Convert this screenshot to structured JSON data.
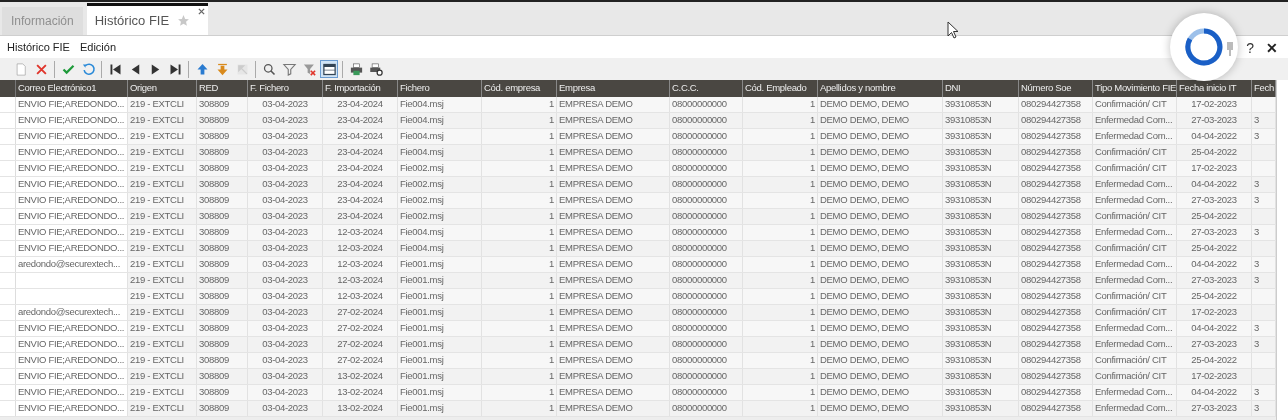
{
  "tabs": [
    {
      "label": "Información",
      "selected": false,
      "closable": false
    },
    {
      "label": "Histórico FIE",
      "selected": true,
      "closable": true
    }
  ],
  "menu": [
    {
      "label": "Histórico FIE"
    },
    {
      "label": "Edición"
    }
  ],
  "window_controls": [
    {
      "kind": "pin"
    },
    {
      "kind": "help",
      "label": "?"
    },
    {
      "kind": "close",
      "label": "✕"
    }
  ],
  "loading": true,
  "toolbar": [
    {
      "kind": "new",
      "disabled": false
    },
    {
      "kind": "delete",
      "disabled": false
    },
    {
      "kind": "separator"
    },
    {
      "kind": "accept",
      "disabled": false
    },
    {
      "kind": "undo",
      "disabled": false
    },
    {
      "kind": "separator"
    },
    {
      "kind": "first",
      "disabled": false
    },
    {
      "kind": "prev",
      "disabled": false
    },
    {
      "kind": "next",
      "disabled": false
    },
    {
      "kind": "last",
      "disabled": false
    },
    {
      "kind": "separator"
    },
    {
      "kind": "up",
      "disabled": false
    },
    {
      "kind": "down",
      "disabled": false
    },
    {
      "kind": "diagonal",
      "disabled": true
    },
    {
      "kind": "separator"
    },
    {
      "kind": "search",
      "disabled": false
    },
    {
      "kind": "filter",
      "disabled": false
    },
    {
      "kind": "clearfilter",
      "disabled": false
    },
    {
      "kind": "grid",
      "disabled": false,
      "pressed": true
    },
    {
      "kind": "separator"
    },
    {
      "kind": "print",
      "disabled": false
    },
    {
      "kind": "preview",
      "disabled": false
    }
  ],
  "table": {
    "columns": [
      "Correo Electrónico1",
      "Origen",
      "RED",
      "F. Fichero",
      "F. Importación",
      "Fichero",
      "Cód. empresa",
      "Empresa",
      "C.C.C.",
      "Cód. Empleado",
      "Apellidos y nombre",
      "DNI",
      "Número Soe",
      "Tipo Movimiento FIE",
      "Fecha inicio IT",
      "Fech"
    ],
    "rows": [
      {
        "correo": "ENVIO FIE;AREDONDO...",
        "origen": "219 - EXTCLI",
        "red": "308809",
        "f_fichero": "03-04-2023",
        "f_importacion": "23-04-2024",
        "fichero": "Fie004.msj",
        "cod_empresa": "1",
        "empresa": "EMPRESA DEMO",
        "ccc": "08000000000",
        "cod_empleado": "1",
        "nombre": "DEMO DEMO, DEMO",
        "dni": "39310853N",
        "soe": "080294427358",
        "tipo": "Confirmación/ CIT",
        "fecha_inicio": "17-02-2023"
      },
      {
        "correo": "ENVIO FIE;AREDONDO...",
        "origen": "219 - EXTCLI",
        "red": "308809",
        "f_fichero": "03-04-2023",
        "f_importacion": "23-04-2024",
        "fichero": "Fie004.msj",
        "cod_empresa": "1",
        "empresa": "EMPRESA DEMO",
        "ccc": "08000000000",
        "cod_empleado": "1",
        "nombre": "DEMO DEMO, DEMO",
        "dni": "39310853N",
        "soe": "080294427358",
        "tipo": "Enfermedad Com...",
        "fecha_inicio": "27-03-2023",
        "column_16": "3"
      },
      {
        "correo": "ENVIO FIE;AREDONDO...",
        "origen": "219 - EXTCLI",
        "red": "308809",
        "f_fichero": "03-04-2023",
        "f_importacion": "23-04-2024",
        "fichero": "Fie004.msj",
        "cod_empresa": "1",
        "empresa": "EMPRESA DEMO",
        "ccc": "08000000000",
        "cod_empleado": "1",
        "nombre": "DEMO DEMO, DEMO",
        "dni": "39310853N",
        "soe": "080294427358",
        "tipo": "Enfermedad Com...",
        "fecha_inicio": "04-04-2022",
        "column_16": "3"
      },
      {
        "correo": "ENVIO FIE;AREDONDO...",
        "origen": "219 - EXTCLI",
        "red": "308809",
        "f_fichero": "03-04-2023",
        "f_importacion": "23-04-2024",
        "fichero": "Fie004.msj",
        "cod_empresa": "1",
        "empresa": "EMPRESA DEMO",
        "ccc": "08000000000",
        "cod_empleado": "1",
        "nombre": "DEMO DEMO, DEMO",
        "dni": "39310853N",
        "soe": "080294427358",
        "tipo": "Confirmación/ CIT",
        "fecha_inicio": "25-04-2022"
      },
      {
        "correo": "ENVIO FIE;AREDONDO...",
        "origen": "219 - EXTCLI",
        "red": "308809",
        "f_fichero": "03-04-2023",
        "f_importacion": "23-04-2024",
        "fichero": "Fie002.msj",
        "cod_empresa": "1",
        "empresa": "EMPRESA DEMO",
        "ccc": "08000000000",
        "cod_empleado": "1",
        "nombre": "DEMO DEMO, DEMO",
        "dni": "39310853N",
        "soe": "080294427358",
        "tipo": "Confirmación/ CIT",
        "fecha_inicio": "17-02-2023"
      },
      {
        "correo": "ENVIO FIE;AREDONDO...",
        "origen": "219 - EXTCLI",
        "red": "308809",
        "f_fichero": "03-04-2023",
        "f_importacion": "23-04-2024",
        "fichero": "Fie002.msj",
        "cod_empresa": "1",
        "empresa": "EMPRESA DEMO",
        "ccc": "08000000000",
        "cod_empleado": "1",
        "nombre": "DEMO DEMO, DEMO",
        "dni": "39310853N",
        "soe": "080294427358",
        "tipo": "Enfermedad Com...",
        "fecha_inicio": "04-04-2022",
        "column_16": "3"
      },
      {
        "correo": "ENVIO FIE;AREDONDO...",
        "origen": "219 - EXTCLI",
        "red": "308809",
        "f_fichero": "03-04-2023",
        "f_importacion": "23-04-2024",
        "fichero": "Fie002.msj",
        "cod_empresa": "1",
        "empresa": "EMPRESA DEMO",
        "ccc": "08000000000",
        "cod_empleado": "1",
        "nombre": "DEMO DEMO, DEMO",
        "dni": "39310853N",
        "soe": "080294427358",
        "tipo": "Enfermedad Com...",
        "fecha_inicio": "27-03-2023",
        "column_16": "3"
      },
      {
        "correo": "ENVIO FIE;AREDONDO...",
        "origen": "219 - EXTCLI",
        "red": "308809",
        "f_fichero": "03-04-2023",
        "f_importacion": "23-04-2024",
        "fichero": "Fie002.msj",
        "cod_empresa": "1",
        "empresa": "EMPRESA DEMO",
        "ccc": "08000000000",
        "cod_empleado": "1",
        "nombre": "DEMO DEMO, DEMO",
        "dni": "39310853N",
        "soe": "080294427358",
        "tipo": "Confirmación/ CIT",
        "fecha_inicio": "25-04-2022"
      },
      {
        "correo": "ENVIO FIE;AREDONDO...",
        "origen": "219 - EXTCLI",
        "red": "308809",
        "f_fichero": "03-04-2023",
        "f_importacion": "12-03-2024",
        "fichero": "Fie004.msj",
        "cod_empresa": "1",
        "empresa": "EMPRESA DEMO",
        "ccc": "08000000000",
        "cod_empleado": "1",
        "nombre": "DEMO DEMO, DEMO",
        "dni": "39310853N",
        "soe": "080294427358",
        "tipo": "Enfermedad Com...",
        "fecha_inicio": "27-03-2023",
        "column_16": "3"
      },
      {
        "correo": "ENVIO FIE;AREDONDO...",
        "origen": "219 - EXTCLI",
        "red": "308809",
        "f_fichero": "03-04-2023",
        "f_importacion": "12-03-2024",
        "fichero": "Fie004.msj",
        "cod_empresa": "1",
        "empresa": "EMPRESA DEMO",
        "ccc": "08000000000",
        "cod_empleado": "1",
        "nombre": "DEMO DEMO, DEMO",
        "dni": "39310853N",
        "soe": "080294427358",
        "tipo": "Confirmación/ CIT",
        "fecha_inicio": "25-04-2022"
      },
      {
        "correo": "aredondo@securextech...",
        "origen": "219 - EXTCLI",
        "red": "308809",
        "f_fichero": "03-04-2023",
        "f_importacion": "12-03-2024",
        "fichero": "Fie001.msj",
        "cod_empresa": "1",
        "empresa": "EMPRESA DEMO",
        "ccc": "08000000000",
        "cod_empleado": "1",
        "nombre": "DEMO DEMO, DEMO",
        "dni": "39310853N",
        "soe": "080294427358",
        "tipo": "Enfermedad Com...",
        "fecha_inicio": "04-04-2022",
        "column_16": "3"
      },
      {
        "origen": "219 - EXTCLI",
        "red": "308809",
        "f_fichero": "03-04-2023",
        "f_importacion": "12-03-2024",
        "fichero": "Fie001.msj",
        "cod_empresa": "1",
        "empresa": "EMPRESA DEMO",
        "ccc": "08000000000",
        "cod_empleado": "1",
        "nombre": "DEMO DEMO, DEMO",
        "dni": "39310853N",
        "soe": "080294427358",
        "tipo": "Enfermedad Com...",
        "fecha_inicio": "27-03-2023",
        "column_16": "3"
      },
      {
        "origen": "219 - EXTCLI",
        "red": "308809",
        "f_fichero": "03-04-2023",
        "f_importacion": "12-03-2024",
        "fichero": "Fie001.msj",
        "cod_empresa": "1",
        "empresa": "EMPRESA DEMO",
        "ccc": "08000000000",
        "cod_empleado": "1",
        "nombre": "DEMO DEMO, DEMO",
        "dni": "39310853N",
        "soe": "080294427358",
        "tipo": "Confirmación/ CIT",
        "fecha_inicio": "25-04-2022"
      },
      {
        "correo": "aredondo@securextech...",
        "origen": "219 - EXTCLI",
        "red": "308809",
        "f_fichero": "03-04-2023",
        "f_importacion": "27-02-2024",
        "fichero": "Fie001.msj",
        "cod_empresa": "1",
        "empresa": "EMPRESA DEMO",
        "ccc": "08000000000",
        "cod_empleado": "1",
        "nombre": "DEMO DEMO, DEMO",
        "dni": "39310853N",
        "soe": "080294427358",
        "tipo": "Confirmación/ CIT",
        "fecha_inicio": "17-02-2023"
      },
      {
        "correo": "ENVIO FIE;AREDONDO...",
        "origen": "219 - EXTCLI",
        "red": "308809",
        "f_fichero": "03-04-2023",
        "f_importacion": "27-02-2024",
        "fichero": "Fie001.msj",
        "cod_empresa": "1",
        "empresa": "EMPRESA DEMO",
        "ccc": "08000000000",
        "cod_empleado": "1",
        "nombre": "DEMO DEMO, DEMO",
        "dni": "39310853N",
        "soe": "080294427358",
        "tipo": "Enfermedad Com...",
        "fecha_inicio": "04-04-2022",
        "column_16": "3"
      },
      {
        "correo": "ENVIO FIE;AREDONDO...",
        "origen": "219 - EXTCLI",
        "red": "308809",
        "f_fichero": "03-04-2023",
        "f_importacion": "27-02-2024",
        "fichero": "Fie001.msj",
        "cod_empresa": "1",
        "empresa": "EMPRESA DEMO",
        "ccc": "08000000000",
        "cod_empleado": "1",
        "nombre": "DEMO DEMO, DEMO",
        "dni": "39310853N",
        "soe": "080294427358",
        "tipo": "Enfermedad Com...",
        "fecha_inicio": "27-03-2023",
        "column_16": "3"
      },
      {
        "correo": "ENVIO FIE;AREDONDO...",
        "origen": "219 - EXTCLI",
        "red": "308809",
        "f_fichero": "03-04-2023",
        "f_importacion": "27-02-2024",
        "fichero": "Fie001.msj",
        "cod_empresa": "1",
        "empresa": "EMPRESA DEMO",
        "ccc": "08000000000",
        "cod_empleado": "1",
        "nombre": "DEMO DEMO, DEMO",
        "dni": "39310853N",
        "soe": "080294427358",
        "tipo": "Confirmación/ CIT",
        "fecha_inicio": "25-04-2022"
      },
      {
        "correo": "ENVIO FIE;AREDONDO...",
        "origen": "219 - EXTCLI",
        "red": "308809",
        "f_fichero": "03-04-2023",
        "f_importacion": "13-02-2024",
        "fichero": "Fie001.msj",
        "cod_empresa": "1",
        "empresa": "EMPRESA DEMO",
        "ccc": "08000000000",
        "cod_empleado": "1",
        "nombre": "DEMO DEMO, DEMO",
        "dni": "39310853N",
        "soe": "080294427358",
        "tipo": "Confirmación/ CIT",
        "fecha_inicio": "17-02-2023"
      },
      {
        "correo": "ENVIO FIE;AREDONDO...",
        "origen": "219 - EXTCLI",
        "red": "308809",
        "f_fichero": "03-04-2023",
        "f_importacion": "13-02-2024",
        "fichero": "Fie001.msj",
        "cod_empresa": "1",
        "empresa": "EMPRESA DEMO",
        "ccc": "08000000000",
        "cod_empleado": "1",
        "nombre": "DEMO DEMO, DEMO",
        "dni": "39310853N",
        "soe": "080294427358",
        "tipo": "Enfermedad Com...",
        "fecha_inicio": "04-04-2022",
        "column_16": "3"
      },
      {
        "correo": "ENVIO FIE;AREDONDO...",
        "origen": "219 - EXTCLI",
        "red": "308809",
        "f_fichero": "03-04-2023",
        "f_importacion": "13-02-2024",
        "fichero": "Fie001.msj",
        "cod_empresa": "1",
        "empresa": "EMPRESA DEMO",
        "ccc": "08000000000",
        "cod_empleado": "1",
        "nombre": "DEMO DEMO, DEMO",
        "dni": "39310853N",
        "soe": "080294427358",
        "tipo": "Enfermedad Com...",
        "fecha_inicio": "27-03-2023",
        "column_16": "3"
      }
    ]
  }
}
